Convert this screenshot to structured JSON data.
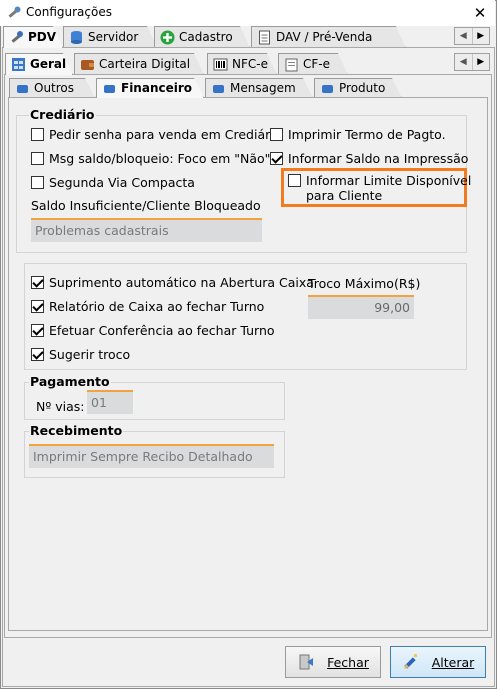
{
  "window": {
    "title": "Configurações",
    "close_glyph": "✕"
  },
  "main_tabs": [
    {
      "label": "PDV",
      "icon": "wrench-icon",
      "active": true
    },
    {
      "label": "Servidor",
      "icon": "database-icon",
      "active": false
    },
    {
      "label": "Cadastro",
      "icon": "green-plus-icon",
      "active": false
    },
    {
      "label": "DAV / Pré-Venda",
      "icon": "document-icon",
      "active": false
    }
  ],
  "sub_tabs": [
    {
      "label": "Geral",
      "icon": "grid-icon",
      "active": true
    },
    {
      "label": "Carteira Digital",
      "icon": "wallet-icon",
      "active": false
    },
    {
      "label": "NFC-e",
      "icon": "barcode-icon",
      "active": false
    },
    {
      "label": "CF-e",
      "icon": "folder-icon",
      "active": false
    }
  ],
  "inner_tabs": [
    {
      "label": "Outros",
      "active": false
    },
    {
      "label": "Financeiro",
      "active": true
    },
    {
      "label": "Mensagem",
      "active": false
    },
    {
      "label": "Produto",
      "active": false
    }
  ],
  "scroll": {
    "left": "◀",
    "right": "▶"
  },
  "crediario": {
    "title": "Crediário",
    "options": {
      "pedir_senha": {
        "label": "Pedir senha para venda em Crediário",
        "checked": false
      },
      "msg_saldo": {
        "label": "Msg saldo/bloqueio: Foco em \"Não\"",
        "checked": false
      },
      "segunda_via": {
        "label": "Segunda Via Compacta",
        "checked": false
      },
      "imprimir_termo": {
        "label": "Imprimir Termo de Pagto.",
        "checked": false
      },
      "informar_saldo": {
        "label": "Informar Saldo na Impressão",
        "checked": true
      },
      "informar_limite": {
        "label": "Informar Limite Disponível para Cliente",
        "label_line1": "Informar Limite Disponível",
        "label_line2": "para Cliente",
        "checked": false
      }
    },
    "saldo_label": "Saldo Insuficiente/Cliente Bloqueado",
    "saldo_value": "Problemas cadastrais"
  },
  "caixa": {
    "suprimento": {
      "label": "Suprimento automático na Abertura Caixa",
      "checked": true
    },
    "relatorio": {
      "label": "Relatório de Caixa ao fechar Turno",
      "checked": true
    },
    "conferencia": {
      "label": "Efetuar Conferência ao fechar Turno",
      "checked": true
    },
    "sugerir": {
      "label": "Sugerir troco",
      "checked": true
    },
    "troco_label": "Troco Máximo(R$)",
    "troco_value": "99,00"
  },
  "pagamento": {
    "title": "Pagamento",
    "vias_label": "Nº vias:",
    "vias_value": "01"
  },
  "recebimento": {
    "title": "Recebimento",
    "value": "Imprimir Sempre Recibo Detalhado"
  },
  "buttons": {
    "fechar": "Fechar",
    "alterar": "Alterar"
  },
  "colors": {
    "highlight": "#f07c1f",
    "field_accent": "#f0a340",
    "field_bg": "#d9dbdd"
  }
}
